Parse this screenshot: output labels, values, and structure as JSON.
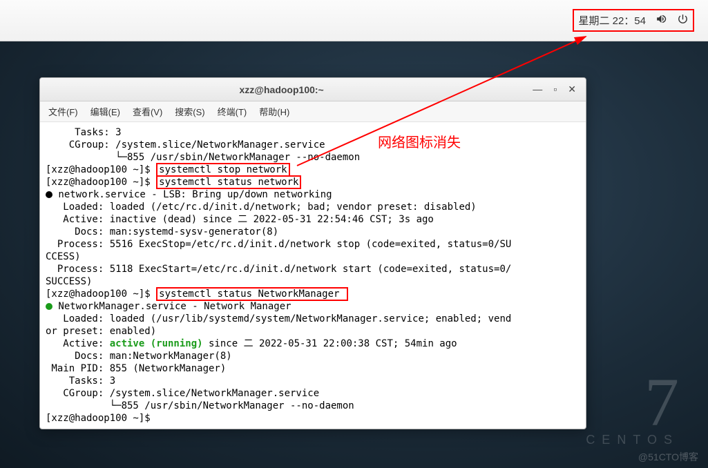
{
  "topbar": {
    "clock": "星期二 22：54"
  },
  "window": {
    "title": "xzz@hadoop100:~"
  },
  "menu": {
    "file": "文件(F)",
    "edit": "编辑(E)",
    "view": "查看(V)",
    "search": "搜索(S)",
    "terminal": "终端(T)",
    "help": "帮助(H)"
  },
  "annotation_text": "网络图标消失",
  "term": {
    "l01": "     Tasks: 3",
    "l02": "    CGroup: /system.slice/NetworkManager.service",
    "l03": "            └─855 /usr/sbin/NetworkManager --no-daemon",
    "p1_prefix": "[xzz@hadoop100 ~]$ ",
    "cmd1": "systemctl stop network",
    "p2_prefix": "[xzz@hadoop100 ~]$ ",
    "cmd2": "systemctl status network",
    "l06": " network.service - LSB: Bring up/down networking",
    "l07": "   Loaded: loaded (/etc/rc.d/init.d/network; bad; vendor preset: disabled)",
    "l08": "   Active: inactive (dead) since 二 2022-05-31 22:54:46 CST; 3s ago",
    "l09": "     Docs: man:systemd-sysv-generator(8)",
    "l10": "  Process: 5516 ExecStop=/etc/rc.d/init.d/network stop (code=exited, status=0/SU",
    "l10b": "CCESS)",
    "l11": "  Process: 5118 ExecStart=/etc/rc.d/init.d/network start (code=exited, status=0/",
    "l11b": "SUCCESS)",
    "p3_prefix": "[xzz@hadoop100 ~]$ ",
    "cmd3": "systemctl status NetworkManager ",
    "l13": " NetworkManager.service - Network Manager",
    "l14": "   Loaded: loaded (/usr/lib/systemd/system/NetworkManager.service; enabled; vend",
    "l14b": "or preset: enabled)",
    "l15a": "   Active: ",
    "l15b": "active (running)",
    "l15c": " since 二 2022-05-31 22:00:38 CST; 54min ago",
    "l16": "     Docs: man:NetworkManager(8)",
    "l17": " Main PID: 855 (NetworkManager)",
    "l18": "    Tasks: 3",
    "l19": "   CGroup: /system.slice/NetworkManager.service",
    "l20": "           └─855 /usr/sbin/NetworkManager --no-daemon",
    "l21": "[xzz@hadoop100 ~]$ "
  },
  "centos": {
    "num": "7",
    "label": "CENTOS"
  },
  "watermark": "@51CTO博客"
}
